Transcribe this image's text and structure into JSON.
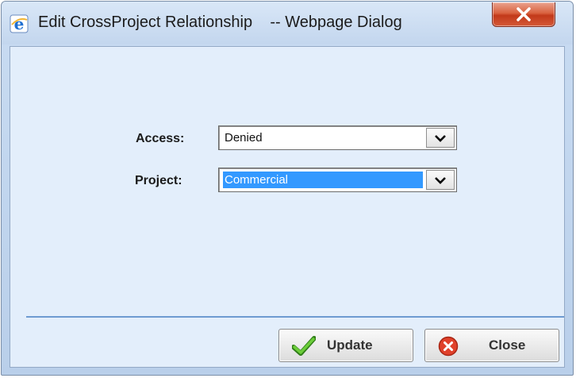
{
  "window": {
    "title": "Edit CrossProject Relationship    -- Webpage Dialog"
  },
  "form": {
    "access": {
      "label": "Access:",
      "value": "Denied"
    },
    "project": {
      "label": "Project:",
      "value": "Commercial"
    }
  },
  "buttons": {
    "update_label": "Update",
    "close_label": "Close"
  },
  "icons": {
    "title": "ie-logo-icon",
    "window_close": "close-x-icon",
    "update": "checkmark-icon",
    "close": "red-x-circle-icon"
  },
  "colors": {
    "selection": "#3399ff",
    "checkmark": "#4caf2a",
    "close_icon": "#e0412b"
  }
}
